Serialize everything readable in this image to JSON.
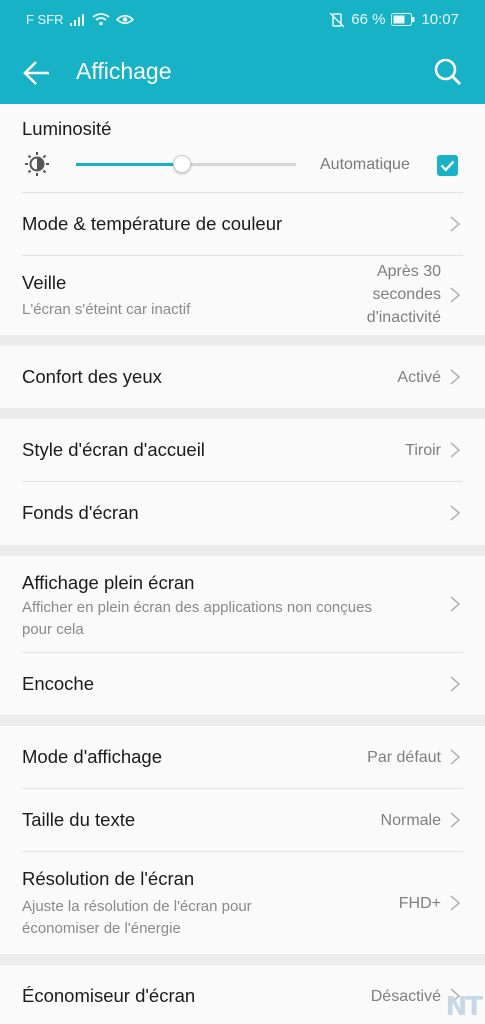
{
  "status_bar": {
    "carrier": "F SFR",
    "battery_percent": "66 %",
    "time": "10:07"
  },
  "app_bar": {
    "title": "Affichage"
  },
  "brightness": {
    "label": "Luminosité",
    "level_fraction": 0.48,
    "auto_label": "Automatique",
    "auto_checked": true
  },
  "rows": {
    "color_mode": {
      "label": "Mode & température de couleur"
    },
    "sleep": {
      "label": "Veille",
      "sub": "L'écran s'éteint car inactif",
      "value_lines": [
        "Après 30",
        "secondes",
        "d'inactivité"
      ]
    },
    "eye_comfort": {
      "label": "Confort des yeux",
      "value": "Activé"
    },
    "home_style": {
      "label": "Style d'écran d'accueil",
      "value": "Tiroir"
    },
    "wallpaper": {
      "label": "Fonds d'écran"
    },
    "fullscreen": {
      "label": "Affichage plein écran",
      "sub_lines": [
        "Afficher en plein écran des applications non conçues",
        "pour cela"
      ]
    },
    "notch": {
      "label": "Encoche"
    },
    "display_mode": {
      "label": "Mode d'affichage",
      "value": "Par défaut"
    },
    "text_size": {
      "label": "Taille du texte",
      "value": "Normale"
    },
    "resolution": {
      "label": "Résolution de l'écran",
      "sub_lines": [
        "Ajuste la résolution de l'écran pour",
        "économiser de l'énergie"
      ],
      "value": "FHD+"
    },
    "screensaver": {
      "label": "Économiseur d'écran",
      "value": "Désactivé"
    }
  },
  "watermark": "NT",
  "colors": {
    "accent": "#17b2c6",
    "background": "#ececec",
    "card": "#fafafa"
  }
}
